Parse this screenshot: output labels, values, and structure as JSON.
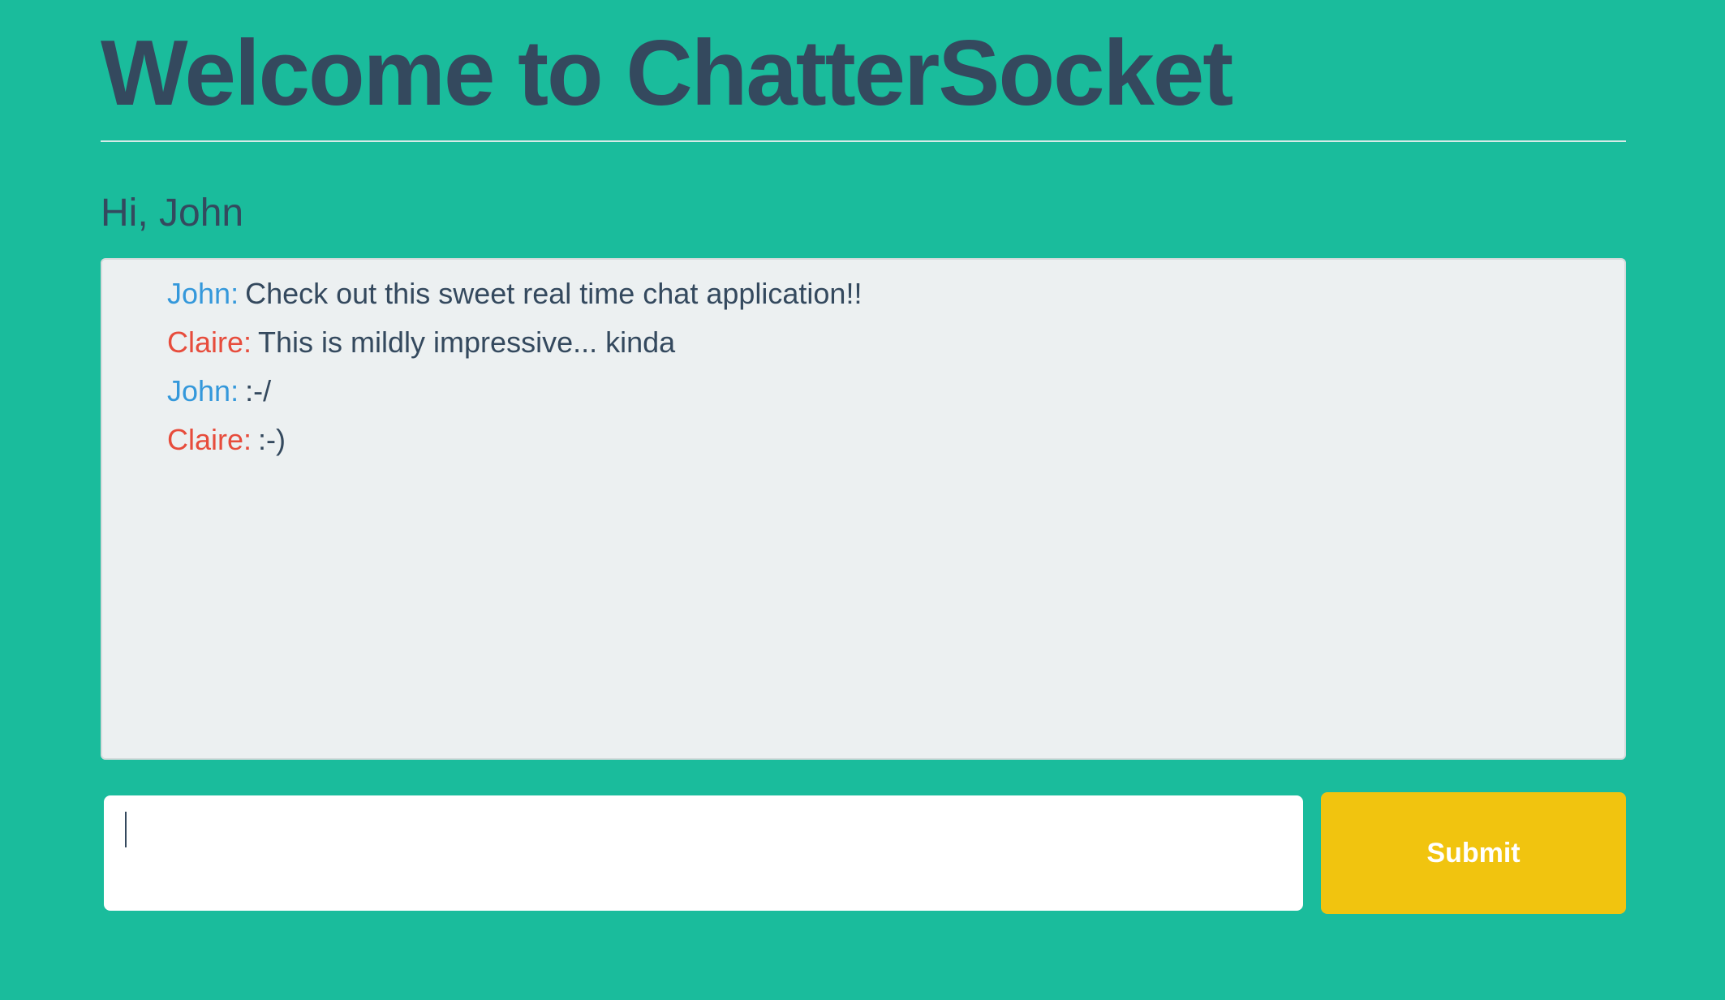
{
  "header": {
    "title": "Welcome to ChatterSocket"
  },
  "greeting": "Hi, John",
  "colors": {
    "background": "#1abc9c",
    "text": "#34495e",
    "john": "#3498db",
    "claire": "#e74c3c",
    "submit": "#f1c40f"
  },
  "messages": [
    {
      "sender": "John:",
      "text": "Check out this sweet real time chat application!!",
      "color": "#3498db"
    },
    {
      "sender": "Claire:",
      "text": "This is mildly impressive... kinda",
      "color": "#e74c3c"
    },
    {
      "sender": "John:",
      "text": ":-/",
      "color": "#3498db"
    },
    {
      "sender": "Claire:",
      "text": ":-)",
      "color": "#e74c3c"
    }
  ],
  "composer": {
    "value": "",
    "placeholder": "",
    "submit_label": "Submit"
  }
}
